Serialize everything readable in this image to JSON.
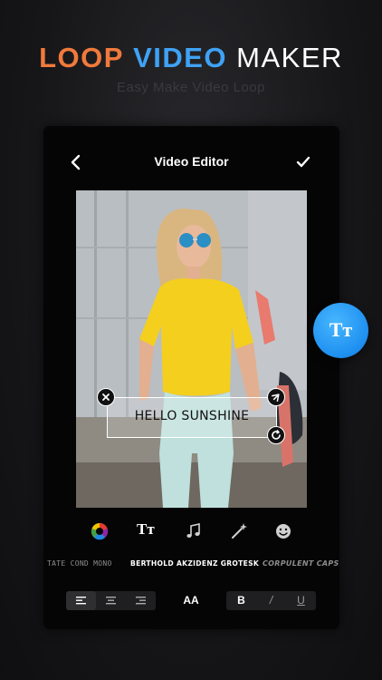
{
  "headline": {
    "part1": "LOOP",
    "part2": "VIDEO",
    "part3": "MAKER"
  },
  "subtitle": "Easy Make Video Loop",
  "colors": {
    "accent_orange": "#f07a3c",
    "accent_blue": "#3fa2f5",
    "fab_blue": "#1e8ff0"
  },
  "editor": {
    "title": "Video Editor",
    "back_icon": "chevron-left-icon",
    "done_icon": "checkmark-icon"
  },
  "preview": {
    "overlay_text": "HELLO SUNSHINE",
    "handles": [
      "close-icon",
      "rotate-icon",
      "refresh-icon"
    ]
  },
  "fab_label": "Tт",
  "toolbar": {
    "items": [
      {
        "icon": "color-wheel-icon"
      },
      {
        "icon": "text-format-icon",
        "label": "Tт"
      },
      {
        "icon": "music-note-icon"
      },
      {
        "icon": "magic-wand-icon"
      },
      {
        "icon": "emoji-icon"
      }
    ]
  },
  "fonts": [
    {
      "name": "TATE COND MONO",
      "selected": false
    },
    {
      "name": "BERTHOLD AKZIDENZ GROTESK",
      "selected": true
    },
    {
      "name": "CORPULENT CAPS",
      "selected": false
    }
  ],
  "formatting": {
    "alignment": [
      "align-left",
      "align-center",
      "align-right"
    ],
    "active_alignment": "align-left",
    "size_label": "AA",
    "bold_label": "B",
    "italic_label": "/",
    "underline_label": "U"
  }
}
